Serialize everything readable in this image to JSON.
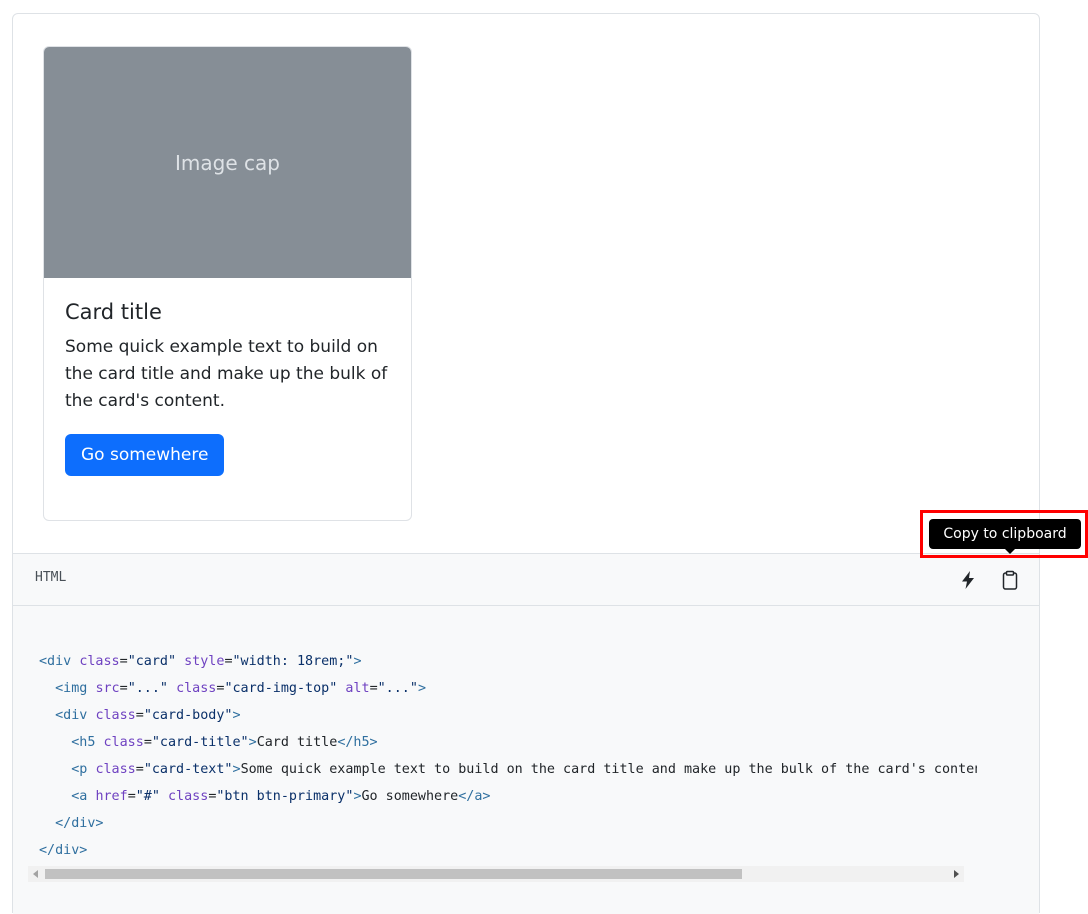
{
  "card": {
    "image_cap": "Image cap",
    "title": "Card title",
    "text": "Some quick example text to build on the card title and make up the bulk of the card's content.",
    "button_label": "Go somewhere"
  },
  "code": {
    "language": "HTML",
    "lines": [
      "<div class=\"card\" style=\"width: 18rem;\">",
      "  <img src=\"...\" class=\"card-img-top\" alt=\"...\">",
      "  <div class=\"card-body\">",
      "    <h5 class=\"card-title\">Card title</h5>",
      "    <p class=\"card-text\">Some quick example text to build on the card title and make up the bulk of the card's content.</p>",
      "    <a href=\"#\" class=\"btn btn-primary\">Go somewhere</a>",
      "  </div>",
      "</div>"
    ]
  },
  "toolbar": {
    "lightning_icon": "lightning-icon",
    "clipboard_icon": "clipboard-icon"
  },
  "tooltip": {
    "text": "Copy to clipboard"
  },
  "colors": {
    "primary": "#0d6efd",
    "image_bg": "#868e96",
    "code_bg": "#f8f9fa",
    "highlight": "#ff0000"
  }
}
